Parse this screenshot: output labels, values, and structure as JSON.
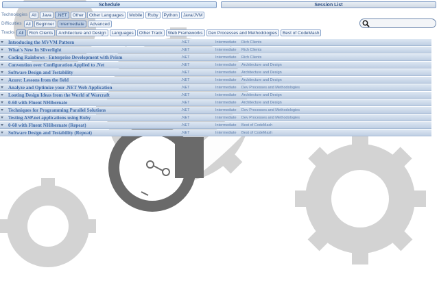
{
  "tabs": [
    {
      "label": "Schedule",
      "active": true
    },
    {
      "label": "Session List",
      "active": false
    }
  ],
  "filters": {
    "technologies": {
      "label": "Technologies",
      "options": [
        "All",
        "Java",
        ".NET",
        "Other",
        "Other Languages",
        "Mobile",
        "Ruby",
        "Python",
        "Java/JVM"
      ],
      "selected": ".NET"
    },
    "difficulties": {
      "label": "Difficulties",
      "options": [
        "All",
        "Beginner",
        "Intermediate",
        "Advanced"
      ],
      "selected": "Intermediate"
    },
    "tracks": {
      "label": "Tracks",
      "options": [
        "All",
        "Rich Clients",
        "Architecture and Design",
        "Languages",
        "Other Track",
        "Web Frameworks",
        "Dev Processes and Methodologies",
        "Best of CodeMash"
      ],
      "selected": "All"
    }
  },
  "search": {
    "placeholder": "",
    "value": "",
    "icon": "search-icon"
  },
  "sessions": [
    {
      "title": "Introducing the MVVM Pattern",
      "technology": ".NET",
      "difficulty": "Intermediate",
      "track": "Rich Clients"
    },
    {
      "title": "What's New In Silverlight",
      "technology": ".NET",
      "difficulty": "Intermediate",
      "track": "Rich Clients"
    },
    {
      "title": "Coding Rainbows - Enterprise Development with Prism",
      "technology": ".NET",
      "difficulty": "Intermediate",
      "track": "Rich Clients"
    },
    {
      "title": "Convention over Configuration Applied to .Net",
      "technology": ".NET",
      "difficulty": "Intermediate",
      "track": "Architecture and Design"
    },
    {
      "title": "Software Design and Testability",
      "technology": ".NET",
      "difficulty": "Intermediate",
      "track": "Architecture and Design"
    },
    {
      "title": "Azure: Lessons from the field",
      "technology": ".NET",
      "difficulty": "Intermediate",
      "track": "Architecture and Design"
    },
    {
      "title": "Analyze and Optimize your .NET Web Application",
      "technology": ".NET",
      "difficulty": "Intermediate",
      "track": "Dev Processes and Methodologies"
    },
    {
      "title": "Looting Design Ideas from the World of Warcraft",
      "technology": ".NET",
      "difficulty": "Intermediate",
      "track": "Architecture and Design"
    },
    {
      "title": "0-60 with Fluent NHibernate",
      "technology": ".NET",
      "difficulty": "Intermediate",
      "track": "Architecture and Design"
    },
    {
      "title": "Techniques for Programming Parallel Solutions",
      "technology": ".NET",
      "difficulty": "Intermediate",
      "track": "Dev Processes and Methodologies"
    },
    {
      "title": "Testing ASP.net applications using Ruby",
      "technology": ".NET",
      "difficulty": "Intermediate",
      "track": "Dev Processes and Methodologies"
    },
    {
      "title": "0-60 with Fluent NHibernate (Repeat)",
      "technology": ".NET",
      "difficulty": "Intermediate",
      "track": "Best of CodeMash"
    },
    {
      "title": "Software Design and Testability (Repeat)",
      "technology": ".NET",
      "difficulty": "Intermediate",
      "track": "Best of CodeMash"
    }
  ],
  "colors": {
    "accent": "#3f6aa8",
    "row_bg": "#c9d7e8",
    "gear": "#cfcfcf",
    "logo": "#6a6a6a"
  }
}
